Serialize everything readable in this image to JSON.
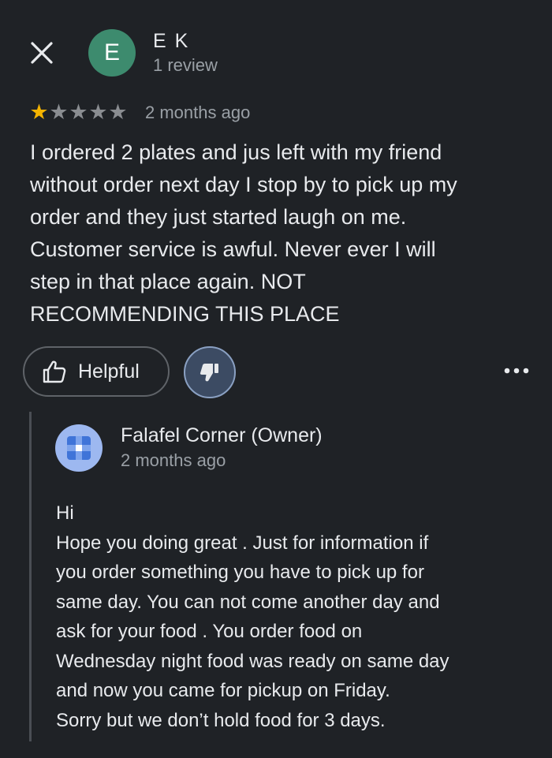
{
  "reviewer": {
    "initial": "E",
    "name": "E K",
    "review_count": "1 review"
  },
  "review": {
    "rating": 1,
    "max_rating": 5,
    "date": "2 months ago",
    "text": "I ordered 2 plates and jus left with my friend\nwithout order next day I stop by to pick up my\norder and they just started laugh on me.\nCustomer service is awful. Never ever I will\nstep in that place again. NOT\nRECOMMENDING THIS PLACE"
  },
  "actions": {
    "helpful_label": "Helpful",
    "helpful_icon": "thumb-up-icon",
    "dislike_icon": "thumb-down-icon",
    "more_icon": "more-horizontal-icon"
  },
  "owner_reply": {
    "name": "Falafel Corner (Owner)",
    "date": "2 months ago",
    "text": "Hi\nHope you doing great . Just for information if\nyou order something you have to pick up for\nsame day. You can not come another day and\nask for your food . You order food on\nWednesday night food was ready on same day\nand now you came for pickup on  Friday.\nSorry but we don’t hold food for 3 days."
  },
  "colors": {
    "background": "#1f2226",
    "star_filled": "#f5b400",
    "star_empty": "#8a8d91",
    "avatar": "#3d8b6e",
    "dislike_active": "#3c4b63"
  }
}
